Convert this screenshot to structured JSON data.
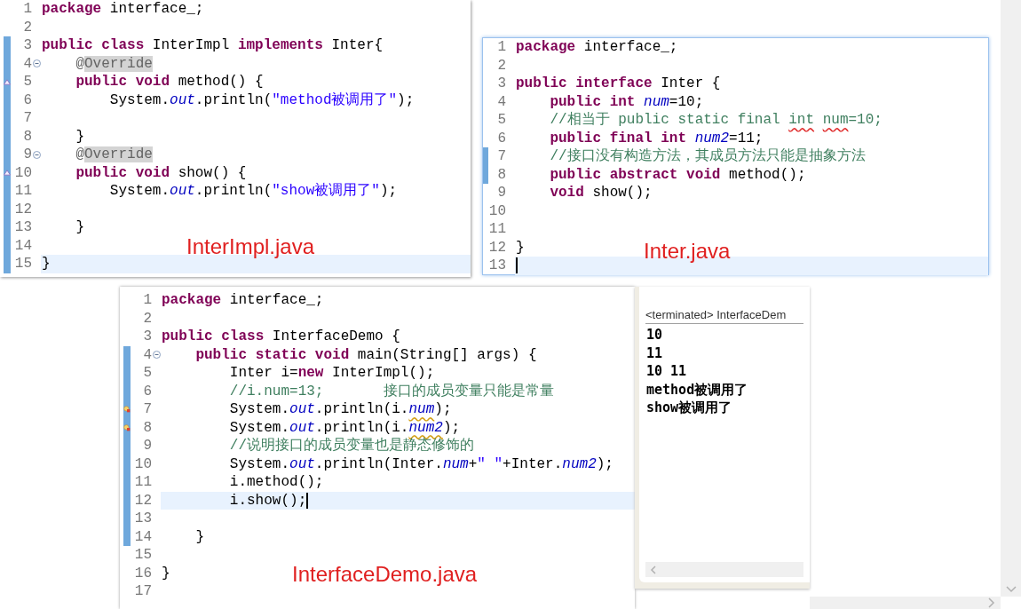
{
  "editors": [
    {
      "caption": "InterImpl.java",
      "caret": false,
      "lines": [
        {
          "number": "1",
          "kind": "plain",
          "changed": false,
          "current": false,
          "tokens": [
            {
              "text": "package",
              "kind": "keyword"
            },
            {
              "text": " interface_;",
              "kind": "plain"
            }
          ]
        },
        {
          "number": "2",
          "kind": "plain",
          "changed": false,
          "current": false
        },
        {
          "number": "3",
          "kind": "plain",
          "changed": true,
          "current": false,
          "tokens": [
            {
              "text": "public",
              "kind": "keyword"
            },
            {
              "text": " class",
              "kind": "keyword"
            },
            {
              "text": " InterImpl",
              "kind": "plain"
            },
            {
              "text": " implements",
              "kind": "keyword"
            },
            {
              "text": " Inter{",
              "kind": "plain"
            }
          ]
        },
        {
          "number": "4",
          "kind": "fold",
          "changed": true,
          "current": false,
          "tokens": [
            {
              "text": "    @",
              "kind": "annotation"
            },
            {
              "text": "Override",
              "kind": "annotation_match"
            }
          ]
        },
        {
          "number": "5",
          "kind": "override",
          "changed": true,
          "current": false,
          "tokens": [
            {
              "text": "    public",
              "kind": "keyword"
            },
            {
              "text": " void",
              "kind": "keyword"
            },
            {
              "text": " method() {",
              "kind": "plain"
            }
          ]
        },
        {
          "number": "6",
          "kind": "plain",
          "changed": true,
          "current": false,
          "tokens": [
            {
              "text": "        System.",
              "kind": "plain"
            },
            {
              "text": "out",
              "kind": "static"
            },
            {
              "text": ".println(",
              "kind": "plain"
            },
            {
              "text": "\"method被调用了\"",
              "kind": "string"
            },
            {
              "text": ");",
              "kind": "plain"
            }
          ]
        },
        {
          "number": "7",
          "kind": "plain",
          "changed": true,
          "current": false
        },
        {
          "number": "8",
          "kind": "plain",
          "changed": true,
          "current": false,
          "tokens": [
            {
              "text": "    }",
              "kind": "plain"
            }
          ]
        },
        {
          "number": "9",
          "kind": "fold",
          "changed": true,
          "current": false,
          "tokens": [
            {
              "text": "    @",
              "kind": "annotation"
            },
            {
              "text": "Override",
              "kind": "annotation_match"
            }
          ]
        },
        {
          "number": "10",
          "kind": "override",
          "changed": true,
          "current": false,
          "tokens": [
            {
              "text": "    public",
              "kind": "keyword"
            },
            {
              "text": " void",
              "kind": "keyword"
            },
            {
              "text": " show() {",
              "kind": "plain"
            }
          ]
        },
        {
          "number": "11",
          "kind": "plain",
          "changed": true,
          "current": false,
          "tokens": [
            {
              "text": "        System.",
              "kind": "plain"
            },
            {
              "text": "out",
              "kind": "static"
            },
            {
              "text": ".println(",
              "kind": "plain"
            },
            {
              "text": "\"show被调用了\"",
              "kind": "string"
            },
            {
              "text": ");",
              "kind": "plain"
            }
          ]
        },
        {
          "number": "12",
          "kind": "plain",
          "changed": true,
          "current": false
        },
        {
          "number": "13",
          "kind": "plain",
          "changed": true,
          "current": false,
          "tokens": [
            {
              "text": "    }",
              "kind": "plain"
            }
          ]
        },
        {
          "number": "14",
          "kind": "plain",
          "changed": true,
          "current": false
        },
        {
          "number": "15",
          "kind": "plain",
          "changed": true,
          "current": true,
          "tokens": [
            {
              "text": "}",
              "kind": "plain"
            }
          ]
        }
      ]
    },
    {
      "caption": "Inter.java",
      "caret": true,
      "lines": [
        {
          "number": "1",
          "kind": "plain",
          "changed": false,
          "current": false,
          "tokens": [
            {
              "text": "package",
              "kind": "keyword"
            },
            {
              "text": " interface_;",
              "kind": "plain"
            }
          ]
        },
        {
          "number": "2",
          "kind": "plain",
          "changed": false,
          "current": false
        },
        {
          "number": "3",
          "kind": "plain",
          "changed": false,
          "current": false,
          "tokens": [
            {
              "text": "public",
              "kind": "keyword"
            },
            {
              "text": " interface",
              "kind": "keyword"
            },
            {
              "text": " Inter {",
              "kind": "plain"
            }
          ]
        },
        {
          "number": "4",
          "kind": "plain",
          "changed": false,
          "current": false,
          "tokens": [
            {
              "text": "    public",
              "kind": "keyword"
            },
            {
              "text": " int ",
              "kind": "keyword"
            },
            {
              "text": "num",
              "kind": "field"
            },
            {
              "text": "=10;",
              "kind": "plain"
            }
          ]
        },
        {
          "number": "5",
          "kind": "plain",
          "changed": false,
          "current": false,
          "tokens": [
            {
              "text": "    //相当于 public static final ",
              "kind": "comment"
            },
            {
              "text": "int",
              "kind": "comment_misspelled"
            },
            {
              "text": " num",
              "kind": "comment_misspelled"
            },
            {
              "text": "=10;",
              "kind": "comment"
            }
          ]
        },
        {
          "number": "6",
          "kind": "plain",
          "changed": false,
          "current": false,
          "tokens": [
            {
              "text": "    public",
              "kind": "keyword"
            },
            {
              "text": " final",
              "kind": "keyword"
            },
            {
              "text": " int ",
              "kind": "keyword"
            },
            {
              "text": "num2",
              "kind": "field"
            },
            {
              "text": "=11;",
              "kind": "plain"
            }
          ]
        },
        {
          "number": "7",
          "kind": "plain",
          "changed": true,
          "current": false,
          "tokens": [
            {
              "text": "    //接口没有构造方法，其成员方法只能是抽象方法",
              "kind": "comment"
            }
          ]
        },
        {
          "number": "8",
          "kind": "plain",
          "changed": true,
          "current": false,
          "tokens": [
            {
              "text": "    public",
              "kind": "keyword"
            },
            {
              "text": " abstract",
              "kind": "keyword"
            },
            {
              "text": " void",
              "kind": "keyword"
            },
            {
              "text": " method();",
              "kind": "plain"
            }
          ]
        },
        {
          "number": "9",
          "kind": "plain",
          "changed": false,
          "current": false,
          "tokens": [
            {
              "text": "    void",
              "kind": "keyword"
            },
            {
              "text": " show();",
              "kind": "plain"
            }
          ]
        },
        {
          "number": "10",
          "kind": "plain",
          "changed": false,
          "current": false
        },
        {
          "number": "11",
          "kind": "plain",
          "changed": false,
          "current": false
        },
        {
          "number": "12",
          "kind": "plain",
          "changed": false,
          "current": false,
          "tokens": [
            {
              "text": "}",
              "kind": "plain"
            }
          ]
        },
        {
          "number": "13",
          "kind": "plain",
          "changed": false,
          "current": true
        }
      ]
    },
    {
      "caption": "InterfaceDemo.java",
      "caret": true,
      "lines": [
        {
          "number": "1",
          "kind": "plain",
          "changed": false,
          "current": false,
          "tokens": [
            {
              "text": "package",
              "kind": "keyword"
            },
            {
              "text": " interface_;",
              "kind": "plain"
            }
          ]
        },
        {
          "number": "2",
          "kind": "plain",
          "changed": false,
          "current": false
        },
        {
          "number": "3",
          "kind": "plain",
          "changed": false,
          "current": false,
          "tokens": [
            {
              "text": "public",
              "kind": "keyword"
            },
            {
              "text": " class",
              "kind": "keyword"
            },
            {
              "text": " InterfaceDemo {",
              "kind": "plain"
            }
          ]
        },
        {
          "number": "4",
          "kind": "fold",
          "changed": true,
          "current": false,
          "tokens": [
            {
              "text": "    public",
              "kind": "keyword"
            },
            {
              "text": " static",
              "kind": "keyword"
            },
            {
              "text": " void",
              "kind": "keyword"
            },
            {
              "text": " main(String[] args) {",
              "kind": "plain"
            }
          ]
        },
        {
          "number": "5",
          "kind": "plain",
          "changed": true,
          "current": false,
          "tokens": [
            {
              "text": "        Inter i=",
              "kind": "plain"
            },
            {
              "text": "new",
              "kind": "keyword"
            },
            {
              "text": " InterImpl();",
              "kind": "plain"
            }
          ]
        },
        {
          "number": "6",
          "kind": "plain",
          "changed": true,
          "current": false,
          "tokens": [
            {
              "text": "        //i.num=13;       接口的成员变量只能是常量",
              "kind": "comment"
            }
          ]
        },
        {
          "number": "7",
          "kind": "warning",
          "changed": true,
          "current": false,
          "tokens": [
            {
              "text": "        System.",
              "kind": "plain"
            },
            {
              "text": "out",
              "kind": "static"
            },
            {
              "text": ".println(i.",
              "kind": "plain"
            },
            {
              "text": "num",
              "kind": "field_warning"
            },
            {
              "text": ");",
              "kind": "plain"
            }
          ]
        },
        {
          "number": "8",
          "kind": "warning",
          "changed": true,
          "current": false,
          "tokens": [
            {
              "text": "        System.",
              "kind": "plain"
            },
            {
              "text": "out",
              "kind": "static"
            },
            {
              "text": ".println(i.",
              "kind": "plain"
            },
            {
              "text": "num2",
              "kind": "field_warning"
            },
            {
              "text": ");",
              "kind": "plain"
            }
          ]
        },
        {
          "number": "9",
          "kind": "plain",
          "changed": true,
          "current": false,
          "tokens": [
            {
              "text": "        //说明接口的成员变量也是静态修饰的",
              "kind": "comment"
            }
          ]
        },
        {
          "number": "10",
          "kind": "plain",
          "changed": true,
          "current": false,
          "tokens": [
            {
              "text": "        System.",
              "kind": "plain"
            },
            {
              "text": "out",
              "kind": "static"
            },
            {
              "text": ".println(Inter.",
              "kind": "plain"
            },
            {
              "text": "num",
              "kind": "field"
            },
            {
              "text": "+",
              "kind": "plain"
            },
            {
              "text": "\" \"",
              "kind": "string"
            },
            {
              "text": "+Inter.",
              "kind": "plain"
            },
            {
              "text": "num2",
              "kind": "field"
            },
            {
              "text": ");",
              "kind": "plain"
            }
          ]
        },
        {
          "number": "11",
          "kind": "plain",
          "changed": true,
          "current": false,
          "tokens": [
            {
              "text": "        i.method();",
              "kind": "plain"
            }
          ]
        },
        {
          "number": "12",
          "kind": "plain",
          "changed": true,
          "current": true,
          "tokens": [
            {
              "text": "        i.show();",
              "kind": "plain"
            }
          ]
        },
        {
          "number": "13",
          "kind": "plain",
          "changed": true,
          "current": false
        },
        {
          "number": "14",
          "kind": "plain",
          "changed": true,
          "current": false,
          "tokens": [
            {
              "text": "    }",
              "kind": "plain"
            }
          ]
        },
        {
          "number": "15",
          "kind": "plain",
          "changed": false,
          "current": false
        },
        {
          "number": "16",
          "kind": "plain",
          "changed": false,
          "current": false,
          "tokens": [
            {
              "text": "}",
              "kind": "plain"
            }
          ]
        },
        {
          "number": "17",
          "kind": "plain",
          "changed": false,
          "current": false
        }
      ]
    }
  ],
  "console": {
    "header": "<terminated> InterfaceDem",
    "lines": [
      "10",
      "11",
      "10 11",
      "method被调用了",
      "show被调用了"
    ]
  }
}
